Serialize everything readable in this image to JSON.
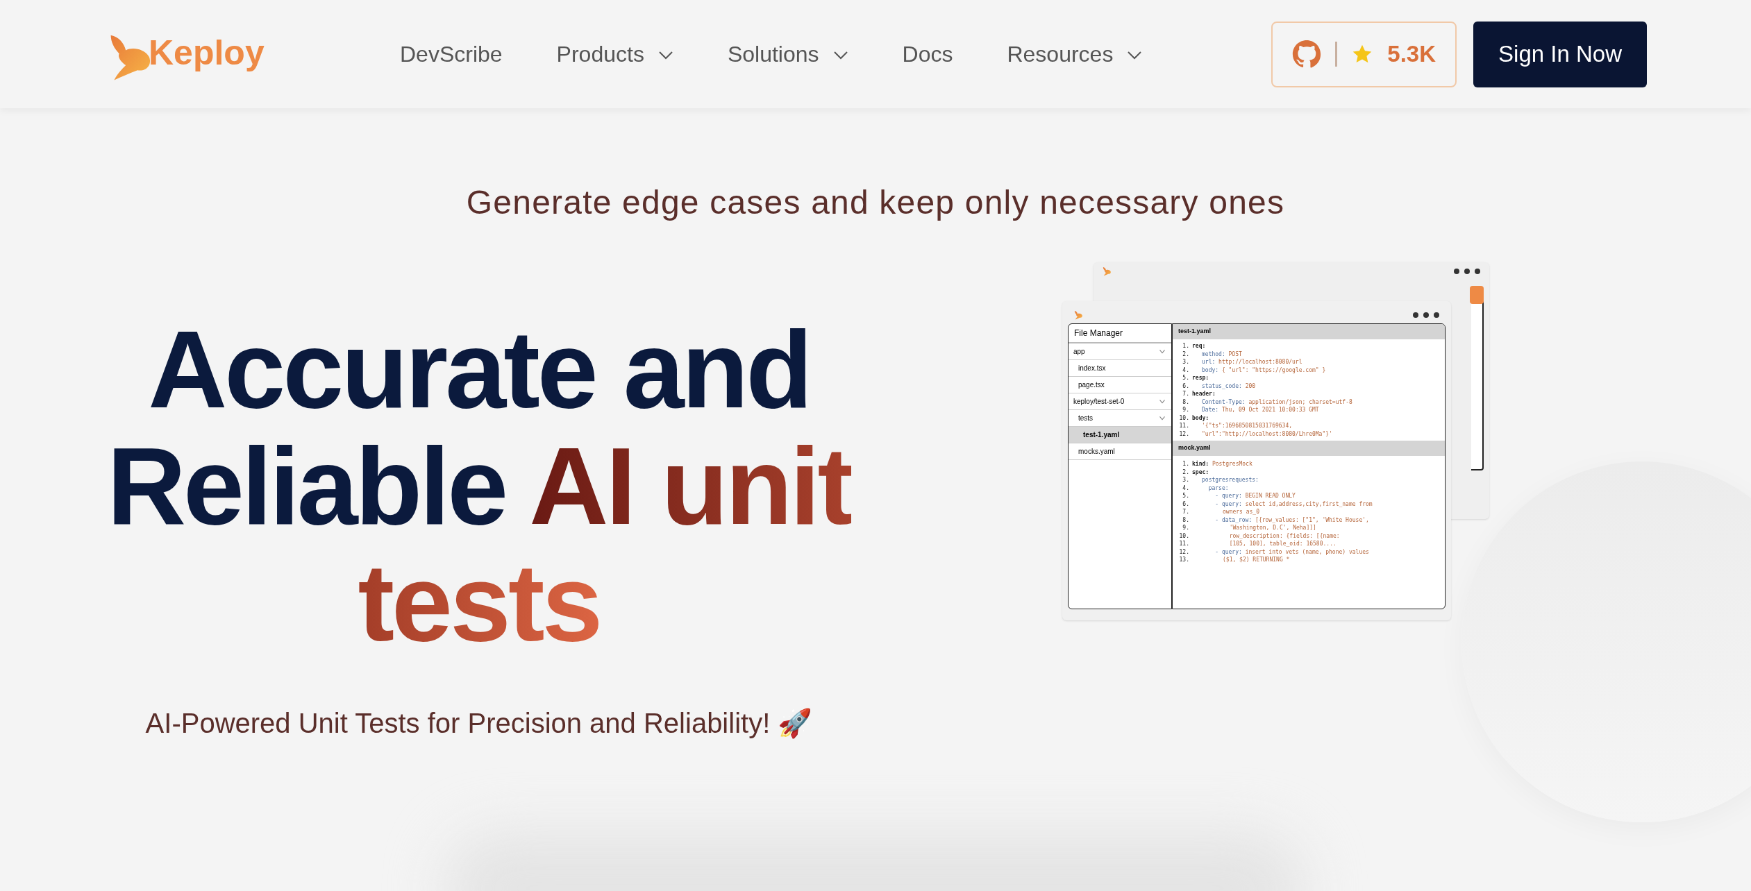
{
  "header": {
    "logo": "Keploy",
    "nav": [
      {
        "label": "DevScribe",
        "dropdown": false
      },
      {
        "label": "Products",
        "dropdown": true
      },
      {
        "label": "Solutions",
        "dropdown": true
      },
      {
        "label": "Docs",
        "dropdown": false
      },
      {
        "label": "Resources",
        "dropdown": true
      }
    ],
    "github": {
      "stars": "5.3K"
    },
    "sign_in": "Sign In Now"
  },
  "tagline": "Generate edge cases and keep only necessary ones",
  "hero": {
    "heading_lines": [
      [
        {
          "text": "Accurate and",
          "kind": "plain"
        }
      ],
      [
        {
          "text": "Reliable ",
          "kind": "plain"
        },
        {
          "text": "AI unit",
          "kind": "accent"
        }
      ],
      [
        {
          "text": "tests",
          "kind": "highlight"
        }
      ]
    ],
    "subtitle": "AI-Powered Unit Tests for Precision and Reliability! 🚀"
  },
  "illustration": {
    "file_manager": {
      "title": "File Manager",
      "items": [
        {
          "label": "app",
          "folder": true,
          "selected": false,
          "children": [
            {
              "label": "index.tsx",
              "folder": false,
              "selected": false
            },
            {
              "label": "page.tsx",
              "folder": false,
              "selected": false
            }
          ]
        },
        {
          "label": "keploy/test-set-0",
          "folder": true,
          "selected": false,
          "children": [
            {
              "label": "tests",
              "folder": true,
              "selected": false,
              "children": [
                {
                  "label": "test-1.yaml",
                  "folder": false,
                  "selected": true
                }
              ]
            },
            {
              "label": "mocks.yaml",
              "folder": false,
              "selected": false
            }
          ]
        }
      ]
    },
    "files": [
      {
        "name": "test-1.yaml",
        "lines": [
          {
            "num": "1.",
            "kind": "key",
            "key": "req:"
          },
          {
            "num": "2.",
            "kind": "field",
            "key": "method:",
            "value": "POST"
          },
          {
            "num": "3.",
            "kind": "field",
            "key": "url:",
            "value": "http://localhost:8080/url"
          },
          {
            "num": "4.",
            "kind": "field",
            "key": "body:",
            "value": "{ \"url\": \"https://google.com\" }"
          },
          {
            "num": "5.",
            "kind": "key",
            "key": "resp:"
          },
          {
            "num": "6.",
            "kind": "field",
            "key": "status_code:",
            "value": "200"
          },
          {
            "num": "7.",
            "kind": "key",
            "key": "header:"
          },
          {
            "num": "8.",
            "kind": "field",
            "key": "Content-Type:",
            "value": "application/json; charset=utf-8"
          },
          {
            "num": "9.",
            "kind": "field",
            "key": "Date:",
            "value": "Thu, 09 Oct 2021 10:00:33 GMT"
          },
          {
            "num": "10.",
            "kind": "key",
            "key": "body:"
          },
          {
            "num": "11.",
            "kind": "field",
            "value": "'{\"ts\":1696850815031769634,"
          },
          {
            "num": "12.",
            "kind": "field",
            "value": "\"url\":\"http://localhost:8080/Lhre0Ma\"}'"
          }
        ]
      },
      {
        "name": "mock.yaml",
        "lines": [
          {
            "num": "1.",
            "kind": "key",
            "key": "kind:",
            "value": "PostgresMock"
          },
          {
            "num": "2.",
            "kind": "key",
            "key": "spec:"
          },
          {
            "num": "3.",
            "kind": "field",
            "key": "postgresrequests:"
          },
          {
            "num": "4.",
            "kind": "field",
            "key": "  parse:"
          },
          {
            "num": "5.",
            "kind": "field",
            "key": "    - query:",
            "value": "BEGIN READ ONLY"
          },
          {
            "num": "6.",
            "kind": "field",
            "key": "    - query:",
            "value": "select id,address,city,first_name from"
          },
          {
            "num": "7.",
            "kind": "cont",
            "value": "owners as_0"
          },
          {
            "num": "8.",
            "kind": "field",
            "key": "    - data_row:",
            "value": "[{row_values: [\"1\", 'White House',"
          },
          {
            "num": "9.",
            "kind": "cont",
            "value": "  'Washington, D.C', Neha]]]"
          },
          {
            "num": "10.",
            "kind": "cont",
            "value": "  row_description: {fields: [{name:"
          },
          {
            "num": "11.",
            "kind": "cont",
            "value": "  [105, 100], table_oid: 16580...."
          },
          {
            "num": "12.",
            "kind": "field",
            "key": "    - query:",
            "value": "insert into vets (name, phone) values"
          },
          {
            "num": "13.",
            "kind": "cont",
            "value": "($1, $2) RETURNING *"
          }
        ]
      }
    ]
  }
}
